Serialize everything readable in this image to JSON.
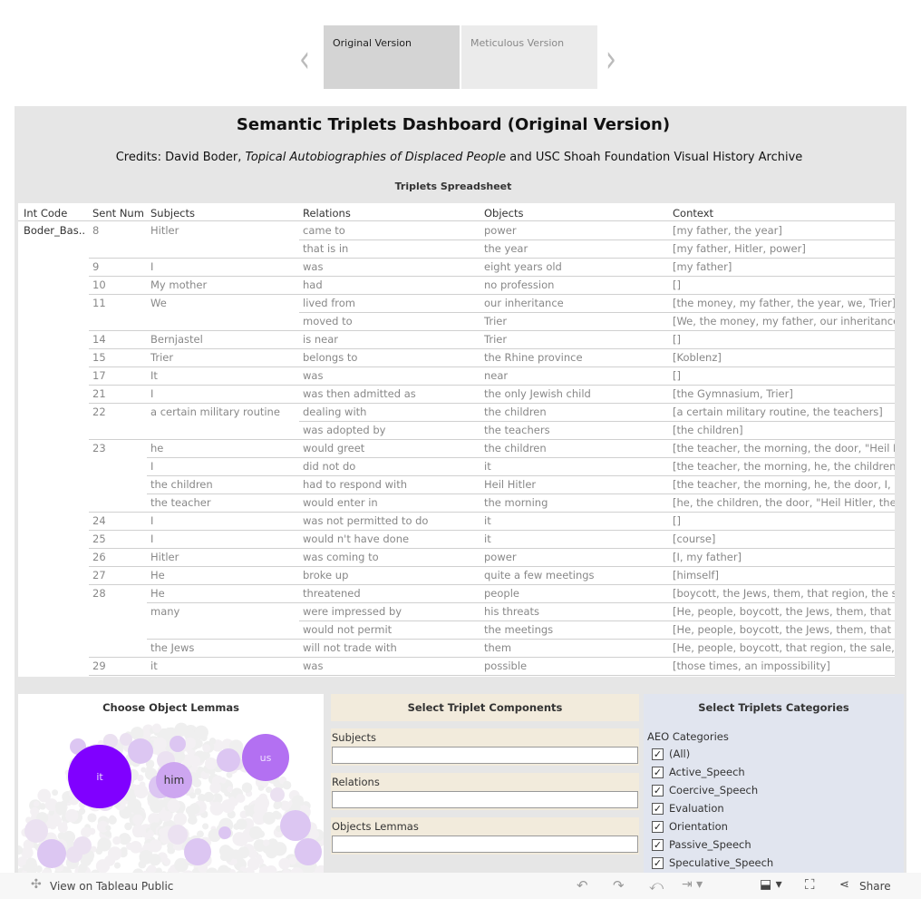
{
  "tabs": [
    {
      "label": "Original Version",
      "active": true
    },
    {
      "label": "Meticulous Version",
      "active": false
    }
  ],
  "nav": {
    "prev": "‹",
    "next": "›"
  },
  "title": "Semantic Triplets Dashboard (Original Version)",
  "credits": {
    "prefix": "Credits: David Boder, ",
    "italic": "Topical Autobiographies of Displaced People",
    "suffix": " and USC Shoah Foundation Visual History Archive"
  },
  "sheet": {
    "title": "Triplets Spreadsheet",
    "columns": [
      "Int Code",
      "Sent Num",
      "Subjects",
      "Relations",
      "Objects",
      "Context"
    ],
    "int_code": "Boder_Bas..",
    "rows": [
      [
        "8",
        "Hitler",
        "came to",
        "power",
        "[my father, the year]"
      ],
      [
        "",
        "",
        "that is in",
        "the year",
        "[my father, Hitler, power]"
      ],
      [
        "9",
        "I",
        "was",
        "eight years old",
        "[my father]"
      ],
      [
        "10",
        "My mother",
        "had",
        "no profession",
        "[]"
      ],
      [
        "11",
        "We",
        "lived from",
        "our inheritance",
        "[the money, my father, the year, we, Trier]"
      ],
      [
        "",
        "",
        "moved to",
        "Trier",
        "[We, the money, my father, our inheritance,"
      ],
      [
        "14",
        "Bernjastel",
        "is near",
        "Trier",
        "[]"
      ],
      [
        "15",
        "Trier",
        "belongs to",
        "the Rhine province",
        "[Koblenz]"
      ],
      [
        "17",
        "It",
        "was",
        "near",
        "[]"
      ],
      [
        "21",
        "I",
        "was then admitted as",
        "the only Jewish child",
        "[the Gymnasium, Trier]"
      ],
      [
        "22",
        "a certain military routine",
        "dealing with",
        "the children",
        "[a certain military routine, the teachers]"
      ],
      [
        "",
        "",
        "was adopted by",
        "the teachers",
        "[the children]"
      ],
      [
        "23",
        "he",
        "would greet",
        "the children",
        "[the teacher, the morning, the door, \"Heil H"
      ],
      [
        "",
        "I",
        "did not do",
        "it",
        "[the teacher, the morning, he, the children,"
      ],
      [
        "",
        "the children",
        "had to respond with",
        "Heil Hitler",
        "[the teacher, the morning, he, the door, I, a"
      ],
      [
        "",
        "the teacher",
        "would enter in",
        "the morning",
        "[he, the children, the door, \"Heil Hitler, the"
      ],
      [
        "24",
        "I",
        "was not permitted to do",
        "it",
        "[]"
      ],
      [
        "25",
        "I",
        "would n't have done",
        "it",
        "[course]"
      ],
      [
        "26",
        "Hitler",
        "was coming to",
        "power",
        "[I, my father]"
      ],
      [
        "27",
        "He",
        "broke up",
        "quite a few meetings",
        "[himself]"
      ],
      [
        "28",
        "He",
        "threatened",
        "people",
        "[boycott, the Jews, them, that region, the s."
      ],
      [
        "",
        "many",
        "were impressed by",
        "his threats",
        "[He, people, boycott, the Jews, them, that r"
      ],
      [
        "",
        "",
        "would not permit",
        "the meetings",
        "[He, people, boycott, the Jews, them, that r"
      ],
      [
        "",
        "the Jews",
        "will not trade with",
        "them",
        "[He, people, boycott, that region, the sale, ."
      ],
      [
        "29",
        "it",
        "was",
        "possible",
        "[those times, an impossibility]"
      ]
    ]
  },
  "lemmas": {
    "title": "Choose Object Lemmas",
    "labeled": [
      {
        "label": "it",
        "color": "#8000ff",
        "text_color": "#e8d8ff"
      },
      {
        "label": "him",
        "color": "#cda6f0",
        "text_color": "#333333"
      },
      {
        "label": "us",
        "color": "#b370f2",
        "text_color": "#efe0ff"
      }
    ],
    "colors": {
      "medium": "#dcc6f2",
      "light": "#ebe1f1",
      "faint": "#efefef"
    }
  },
  "components": {
    "title": "Select Triplet Components",
    "fields": [
      {
        "label": "Subjects",
        "value": ""
      },
      {
        "label": "Relations",
        "value": ""
      },
      {
        "label": "Objects Lemmas",
        "value": ""
      }
    ]
  },
  "categories": {
    "title": "Select Triplets Categories",
    "label": "AEO Categories",
    "items": [
      {
        "label": "(All)",
        "checked": true
      },
      {
        "label": "Active_Speech",
        "checked": true
      },
      {
        "label": "Coercive_Speech",
        "checked": true
      },
      {
        "label": "Evaluation",
        "checked": true
      },
      {
        "label": "Orientation",
        "checked": true
      },
      {
        "label": "Passive_Speech",
        "checked": true
      },
      {
        "label": "Speculative_Speech",
        "checked": true
      }
    ]
  },
  "footer": {
    "view": "View on Tableau Public",
    "share": "Share",
    "icons": [
      "tableau-icon",
      "undo-icon",
      "redo-icon",
      "revert-icon",
      "refresh-icon",
      "download-icon",
      "fullscreen-icon",
      "share-icon"
    ]
  }
}
